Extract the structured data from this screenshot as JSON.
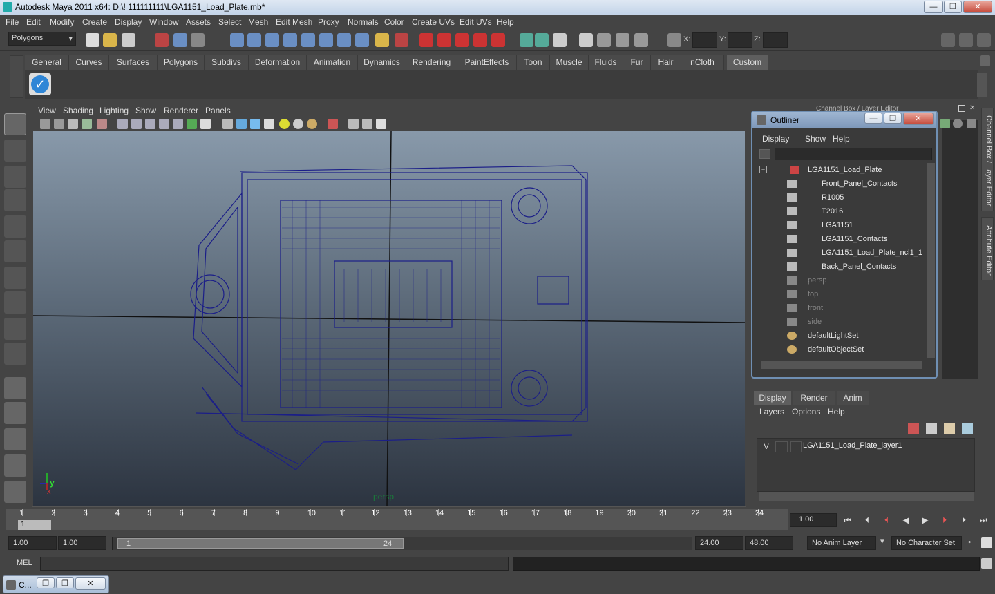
{
  "window": {
    "title": "Autodesk Maya 2011 x64: D:\\! 111111111\\LGA1151_Load_Plate.mb*",
    "min_glyph": "—",
    "max_glyph": "❐",
    "close_glyph": "✕"
  },
  "menubar": [
    "File",
    "Edit",
    "Modify",
    "Create",
    "Display",
    "Window",
    "Assets",
    "Select",
    "Mesh",
    "Edit Mesh",
    "Proxy",
    "Normals",
    "Color",
    "Create UVs",
    "Edit UVs",
    "Help"
  ],
  "status_line": {
    "menu_set": "Polygons",
    "coord_labels": [
      "X:",
      "Y:",
      "Z:"
    ]
  },
  "shelf": {
    "tabs": [
      "General",
      "Curves",
      "Surfaces",
      "Polygons",
      "Subdivs",
      "Deformation",
      "Animation",
      "Dynamics",
      "Rendering",
      "PaintEffects",
      "Toon",
      "Muscle",
      "Fluids",
      "Fur",
      "Hair",
      "nCloth",
      "Custom"
    ],
    "active_tab": "Custom"
  },
  "viewport": {
    "menus": [
      "View",
      "Shading",
      "Lighting",
      "Show",
      "Renderer",
      "Panels"
    ],
    "camera_label": "persp",
    "axis_y": "y",
    "axis_x": "x"
  },
  "outliner": {
    "title": "Outliner",
    "menus": [
      "Display",
      "Show",
      "Help"
    ],
    "root": "LGA1151_Load_Plate",
    "children": [
      "Front_Panel_Contacts",
      "R1005",
      "T2016",
      "LGA1151",
      "LGA1151_Contacts",
      "LGA1151_Load_Plate_ncl1_1",
      "Back_Panel_Contacts"
    ],
    "cameras": [
      "persp",
      "top",
      "front",
      "side"
    ],
    "sets": [
      "defaultLightSet",
      "defaultObjectSet"
    ]
  },
  "channel_box_header": "Channel Box / Layer Editor",
  "side_tabs": [
    "Channel Box / Layer Editor",
    "Attribute Editor"
  ],
  "layer_editor": {
    "tabs": [
      "Display",
      "Render",
      "Anim"
    ],
    "active_tab": "Display",
    "menus": [
      "Layers",
      "Options",
      "Help"
    ],
    "layer": {
      "visible": "V",
      "name": "LGA1151_Load_Plate_layer1"
    }
  },
  "time_slider": {
    "ticks": [
      "1",
      "2",
      "3",
      "4",
      "5",
      "6",
      "7",
      "8",
      "9",
      "10",
      "11",
      "12",
      "13",
      "14",
      "15",
      "16",
      "17",
      "18",
      "19",
      "20",
      "21",
      "22",
      "23",
      "24"
    ],
    "current_frame_marker": "1",
    "current_time": "1.00"
  },
  "range_slider": {
    "start_time": "1.00",
    "playback_start": "1.00",
    "range_start": "1",
    "range_end": "24",
    "playback_end": "24.00",
    "end_time": "48.00",
    "anim_layer": "No Anim Layer",
    "character_set": "No Character Set"
  },
  "command_line": {
    "label": "MEL"
  },
  "minimized_window": {
    "label": "C..."
  },
  "colors": {
    "wireframe": "#1b1e88",
    "accent": "#6f8fb3"
  }
}
